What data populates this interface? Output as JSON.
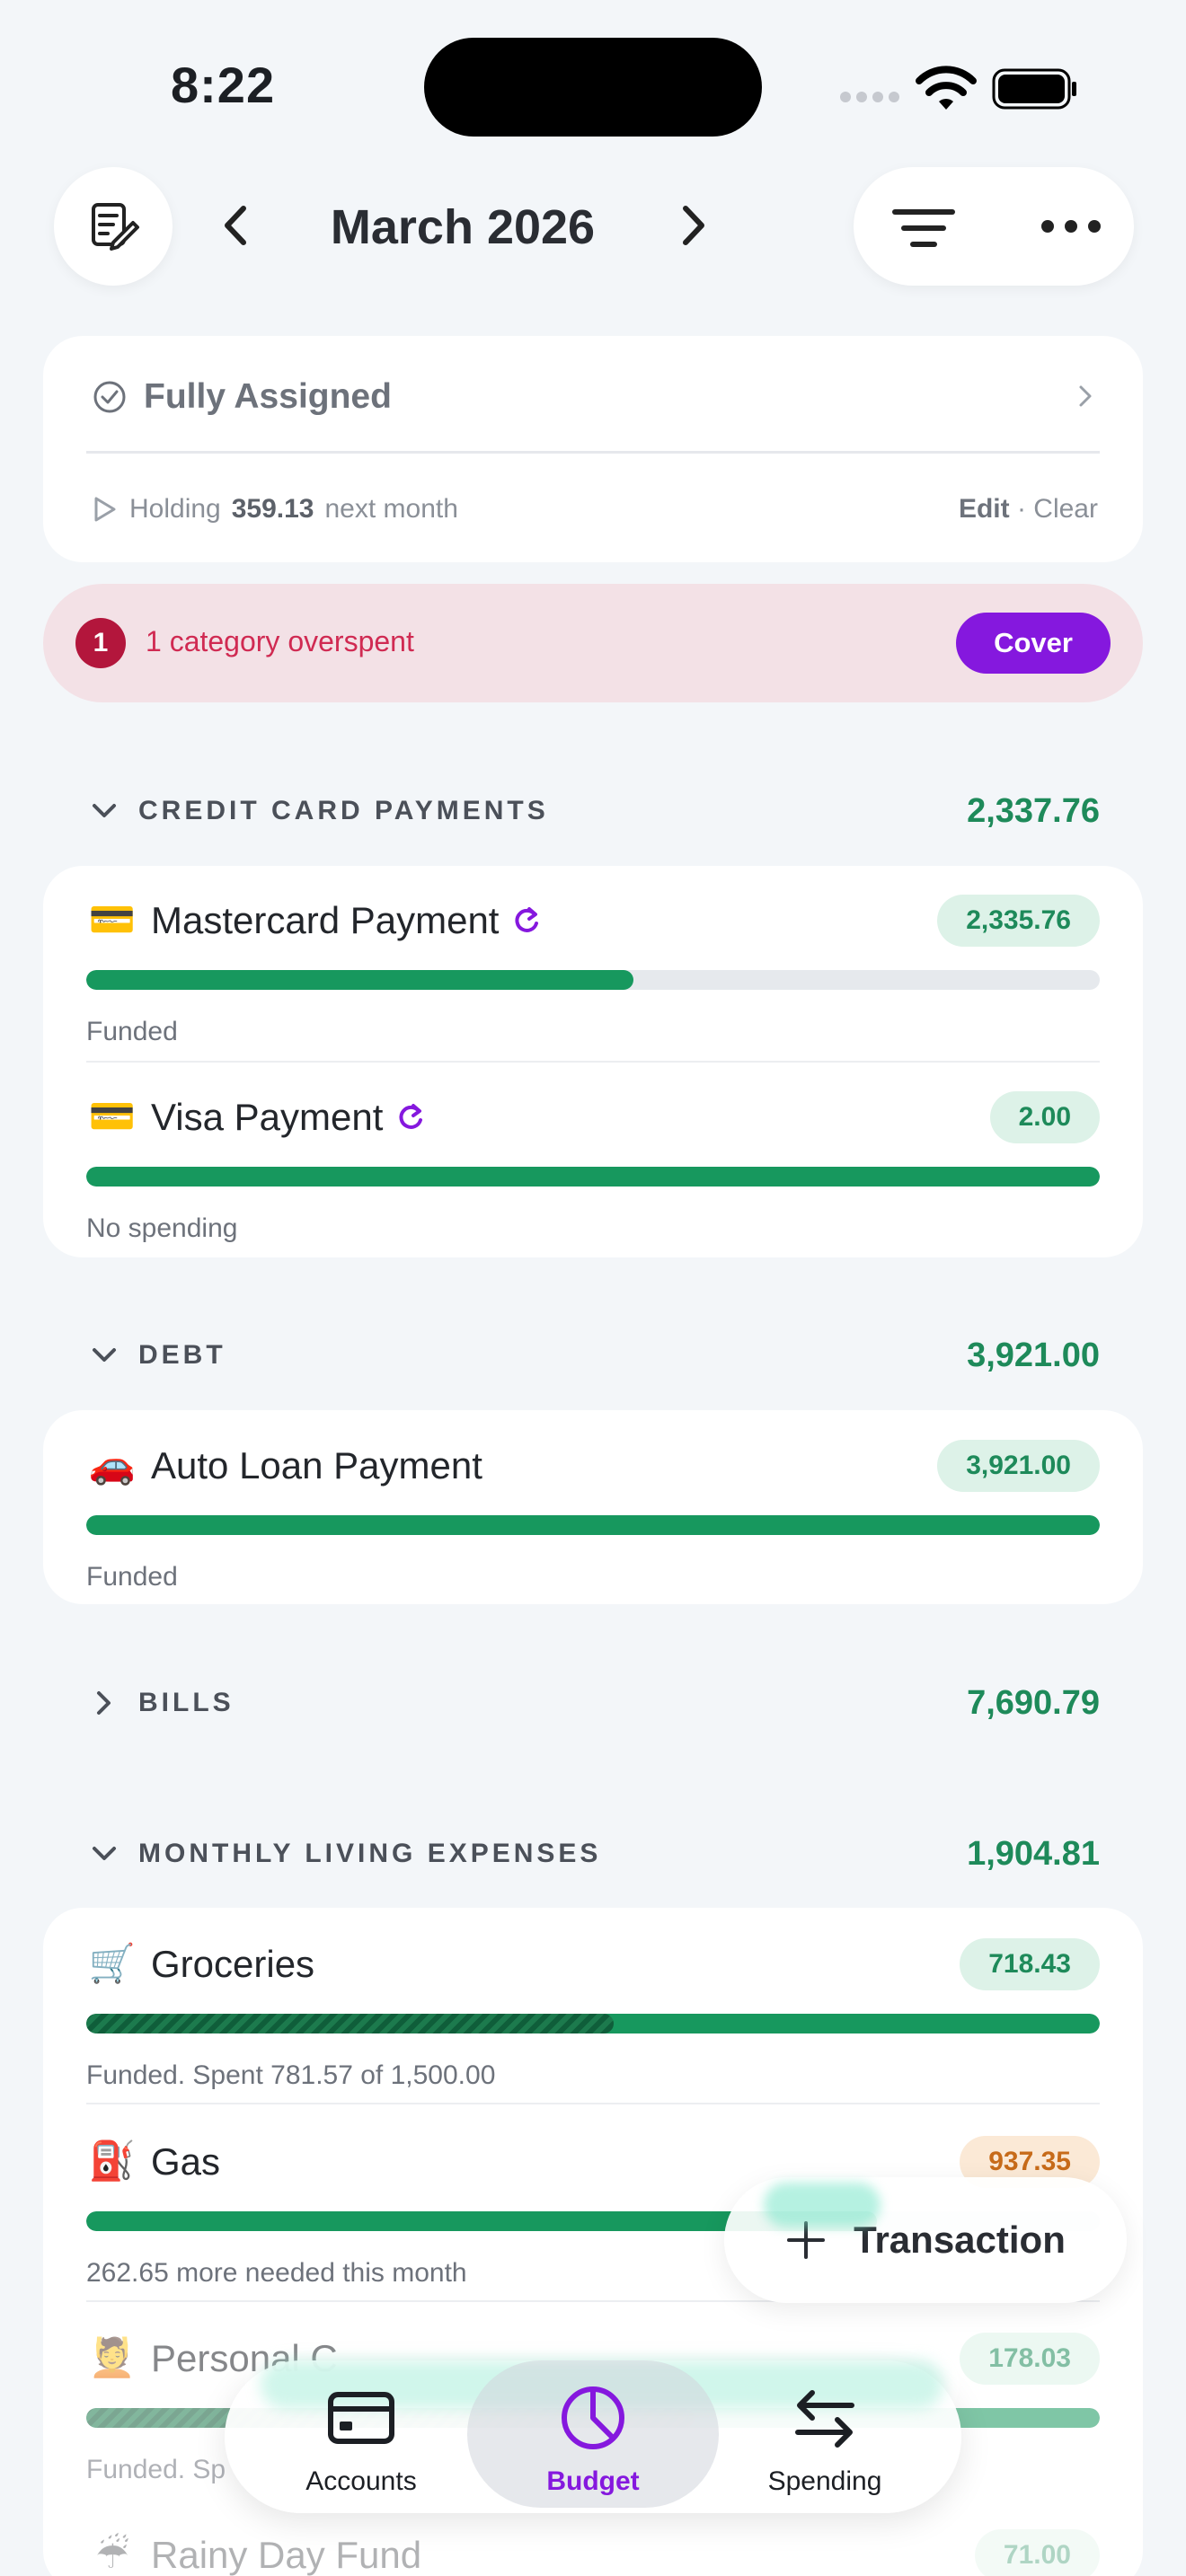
{
  "status_bar": {
    "time": "8:22"
  },
  "header": {
    "month": "March 2026"
  },
  "assigned": {
    "title": "Fully Assigned",
    "holding_prefix": "Holding",
    "holding_amount": "359.13",
    "holding_suffix": "next month",
    "edit": "Edit",
    "separator": "·",
    "clear": "Clear"
  },
  "alert": {
    "count": "1",
    "text": "1 category overspent",
    "action": "Cover"
  },
  "groups": [
    {
      "name": "CREDIT CARD PAYMENTS",
      "total": "2,337.76",
      "items": [
        {
          "emoji": "💳",
          "name": "Mastercard Payment",
          "amount": "2,335.76",
          "status": "Funded",
          "funded_fraction": 0.54
        },
        {
          "emoji": "💳",
          "name": "Visa Payment",
          "amount": "2.00",
          "status": "No spending",
          "funded_fraction": 1.0
        }
      ]
    },
    {
      "name": "DEBT",
      "total": "3,921.00",
      "items": [
        {
          "emoji": "🚗",
          "name": "Auto Loan Payment",
          "amount": "3,921.00",
          "status": "Funded",
          "funded_fraction": 1.0
        }
      ]
    },
    {
      "name": "BILLS",
      "total": "7,690.79",
      "items": []
    },
    {
      "name": "MONTHLY LIVING EXPENSES",
      "total": "1,904.81",
      "items": [
        {
          "emoji": "🛒",
          "name": "Groceries",
          "amount": "718.43",
          "status": "Funded. Spent 781.57 of 1,500.00",
          "funded_fraction": 1.0,
          "spent_fraction": 0.52
        },
        {
          "emoji": "⛽",
          "name": "Gas",
          "amount": "937.35",
          "status": "262.65 more needed this month",
          "funded_fraction": 0.78
        },
        {
          "emoji": "💆",
          "name": "Personal C",
          "amount": "178.03",
          "status": "Funded. Sp",
          "funded_fraction": 1.0,
          "spent_fraction": 0.6
        },
        {
          "emoji": "☔",
          "name": "Rainy Day Fund",
          "amount": "71.00"
        }
      ]
    }
  ],
  "fab": {
    "label": "Transaction"
  },
  "tabs": [
    {
      "label": "Accounts",
      "icon": "card-icon"
    },
    {
      "label": "Budget",
      "icon": "pie-chart-icon",
      "active": true
    },
    {
      "label": "Spending",
      "icon": "arrows-icon"
    }
  ],
  "colors": {
    "accent": "#8518de",
    "positive": "#17985e",
    "warning": "#c76b1a",
    "alert": "#d02a52"
  }
}
